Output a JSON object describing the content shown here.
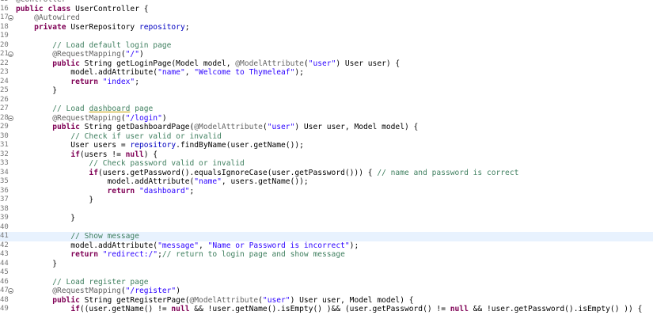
{
  "editor": {
    "language": "java",
    "current_line": 41,
    "colors": {
      "keyword": "#7f0055",
      "comment": "#3f7f5f",
      "annotation": "#646464",
      "string": "#2a00ff",
      "field": "#0000c0",
      "line_number": "#787878",
      "current_line_bg": "#e8f2fe"
    },
    "lines": [
      {
        "n": "15",
        "fold": false,
        "tokens": [
          [
            "an",
            "@Controller"
          ]
        ]
      },
      {
        "n": "16",
        "fold": false,
        "tokens": [
          [
            "kw",
            "public"
          ],
          [
            "tx",
            " "
          ],
          [
            "kw",
            "class"
          ],
          [
            "tx",
            " UserController {"
          ]
        ]
      },
      {
        "n": "17",
        "fold": true,
        "tokens": [
          [
            "tx",
            "    "
          ],
          [
            "an",
            "@Autowired"
          ]
        ]
      },
      {
        "n": "18",
        "fold": false,
        "tokens": [
          [
            "tx",
            "    "
          ],
          [
            "kw",
            "private"
          ],
          [
            "tx",
            " UserRepository "
          ],
          [
            "fd",
            "repository"
          ],
          [
            "tx",
            ";"
          ]
        ]
      },
      {
        "n": "19",
        "fold": false,
        "tokens": []
      },
      {
        "n": "20",
        "fold": false,
        "tokens": [
          [
            "tx",
            "        "
          ],
          [
            "cm",
            "// Load default login page"
          ]
        ]
      },
      {
        "n": "21",
        "fold": true,
        "tokens": [
          [
            "tx",
            "        "
          ],
          [
            "an",
            "@RequestMapping"
          ],
          [
            "tx",
            "("
          ],
          [
            "st",
            "\"/\""
          ],
          [
            "tx",
            ")"
          ]
        ]
      },
      {
        "n": "22",
        "fold": false,
        "tokens": [
          [
            "tx",
            "        "
          ],
          [
            "kw",
            "public"
          ],
          [
            "tx",
            " String getLoginPage(Model model, "
          ],
          [
            "an",
            "@ModelAttribute"
          ],
          [
            "tx",
            "("
          ],
          [
            "st",
            "\"user\""
          ],
          [
            "tx",
            ") User user) {"
          ]
        ]
      },
      {
        "n": "23",
        "fold": false,
        "tokens": [
          [
            "tx",
            "            model.addAttribute("
          ],
          [
            "st",
            "\"name\""
          ],
          [
            "tx",
            ", "
          ],
          [
            "st",
            "\"Welcome to Thymeleaf\""
          ],
          [
            "tx",
            ");"
          ]
        ]
      },
      {
        "n": "24",
        "fold": false,
        "tokens": [
          [
            "tx",
            "            "
          ],
          [
            "kw",
            "return"
          ],
          [
            "tx",
            " "
          ],
          [
            "st",
            "\"index\""
          ],
          [
            "tx",
            ";"
          ]
        ]
      },
      {
        "n": "25",
        "fold": false,
        "tokens": [
          [
            "tx",
            "        }"
          ]
        ]
      },
      {
        "n": "26",
        "fold": false,
        "tokens": []
      },
      {
        "n": "27",
        "fold": false,
        "tokens": [
          [
            "tx",
            "        "
          ],
          [
            "cm",
            "// Load "
          ],
          [
            "ul",
            "dashboard"
          ],
          [
            "cm",
            " page"
          ]
        ]
      },
      {
        "n": "28",
        "fold": true,
        "tokens": [
          [
            "tx",
            "        "
          ],
          [
            "an",
            "@RequestMapping"
          ],
          [
            "tx",
            "("
          ],
          [
            "st",
            "\"/login\""
          ],
          [
            "tx",
            ")"
          ]
        ]
      },
      {
        "n": "29",
        "fold": false,
        "tokens": [
          [
            "tx",
            "        "
          ],
          [
            "kw",
            "public"
          ],
          [
            "tx",
            " String getDashboardPage("
          ],
          [
            "an",
            "@ModelAttribute"
          ],
          [
            "tx",
            "("
          ],
          [
            "st",
            "\"user\""
          ],
          [
            "tx",
            ") User user, Model model) {"
          ]
        ]
      },
      {
        "n": "30",
        "fold": false,
        "tokens": [
          [
            "tx",
            "            "
          ],
          [
            "cm",
            "// Check if user valid or invalid"
          ]
        ]
      },
      {
        "n": "31",
        "fold": false,
        "tokens": [
          [
            "tx",
            "            User users = "
          ],
          [
            "fd",
            "repository"
          ],
          [
            "tx",
            ".findByName(user.getName());"
          ]
        ]
      },
      {
        "n": "32",
        "fold": false,
        "tokens": [
          [
            "tx",
            "            "
          ],
          [
            "kw",
            "if"
          ],
          [
            "tx",
            "(users != "
          ],
          [
            "kw",
            "null"
          ],
          [
            "tx",
            ") {"
          ]
        ]
      },
      {
        "n": "33",
        "fold": false,
        "tokens": [
          [
            "tx",
            "                "
          ],
          [
            "cm",
            "// Check password valid or invalid"
          ]
        ]
      },
      {
        "n": "34",
        "fold": false,
        "tokens": [
          [
            "tx",
            "                "
          ],
          [
            "kw",
            "if"
          ],
          [
            "tx",
            "(users.getPassword().equalsIgnoreCase(user.getPassword())) { "
          ],
          [
            "cm",
            "// name and password is correct"
          ]
        ]
      },
      {
        "n": "35",
        "fold": false,
        "tokens": [
          [
            "tx",
            "                    model.addAttribute("
          ],
          [
            "st",
            "\"name\""
          ],
          [
            "tx",
            ", users.getName());"
          ]
        ]
      },
      {
        "n": "36",
        "fold": false,
        "tokens": [
          [
            "tx",
            "                    "
          ],
          [
            "kw",
            "return"
          ],
          [
            "tx",
            " "
          ],
          [
            "st",
            "\"dashboard\""
          ],
          [
            "tx",
            ";"
          ]
        ]
      },
      {
        "n": "37",
        "fold": false,
        "tokens": [
          [
            "tx",
            "                }"
          ]
        ]
      },
      {
        "n": "38",
        "fold": false,
        "tokens": []
      },
      {
        "n": "39",
        "fold": false,
        "tokens": [
          [
            "tx",
            "            }"
          ]
        ]
      },
      {
        "n": "40",
        "fold": false,
        "tokens": []
      },
      {
        "n": "41",
        "fold": false,
        "tokens": [
          [
            "tx",
            "            "
          ],
          [
            "cm",
            "// Show message"
          ]
        ]
      },
      {
        "n": "42",
        "fold": false,
        "tokens": [
          [
            "tx",
            "            model.addAttribute("
          ],
          [
            "st",
            "\"message\""
          ],
          [
            "tx",
            ", "
          ],
          [
            "st",
            "\"Name or Password is incorrect\""
          ],
          [
            "tx",
            ");"
          ]
        ]
      },
      {
        "n": "43",
        "fold": false,
        "tokens": [
          [
            "tx",
            "            "
          ],
          [
            "kw",
            "return"
          ],
          [
            "tx",
            " "
          ],
          [
            "st",
            "\"redirect:/\""
          ],
          [
            "tx",
            ";"
          ],
          [
            "cm",
            "// return to login page and show message"
          ]
        ]
      },
      {
        "n": "44",
        "fold": false,
        "tokens": [
          [
            "tx",
            "        }"
          ]
        ]
      },
      {
        "n": "45",
        "fold": false,
        "tokens": []
      },
      {
        "n": "46",
        "fold": false,
        "tokens": [
          [
            "tx",
            "        "
          ],
          [
            "cm",
            "// Load register page"
          ]
        ]
      },
      {
        "n": "47",
        "fold": true,
        "tokens": [
          [
            "tx",
            "        "
          ],
          [
            "an",
            "@RequestMapping"
          ],
          [
            "tx",
            "("
          ],
          [
            "st",
            "\"/register\""
          ],
          [
            "tx",
            ")"
          ]
        ]
      },
      {
        "n": "48",
        "fold": false,
        "tokens": [
          [
            "tx",
            "        "
          ],
          [
            "kw",
            "public"
          ],
          [
            "tx",
            " String getRegisterPage("
          ],
          [
            "an",
            "@ModelAttribute"
          ],
          [
            "tx",
            "("
          ],
          [
            "st",
            "\"user\""
          ],
          [
            "tx",
            ") User user, Model model) {"
          ]
        ]
      },
      {
        "n": "49",
        "fold": false,
        "tokens": [
          [
            "tx",
            "            "
          ],
          [
            "kw",
            "if"
          ],
          [
            "tx",
            "((user.getName() != "
          ],
          [
            "kw",
            "null"
          ],
          [
            "tx",
            " && !user.getName().isEmpty() )&& (user.getPassword() != "
          ],
          [
            "kw",
            "null"
          ],
          [
            "tx",
            " && !user.getPassword().isEmpty() )) {"
          ]
        ]
      }
    ]
  }
}
